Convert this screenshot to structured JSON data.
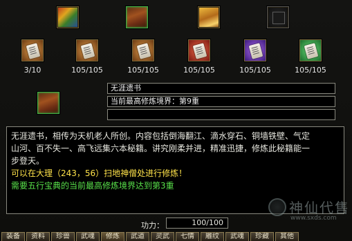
{
  "top_slots": [
    {
      "icon": "multicolor-book-icon",
      "selected": false
    },
    {
      "icon": "scroll-bundle-icon",
      "selected": true
    },
    {
      "icon": "golden-scroll-icon",
      "selected": false
    },
    {
      "icon": "empty-slot-icon",
      "selected": false
    }
  ],
  "scroll_slots": [
    {
      "icon": "white-scroll-icon",
      "color": "#b07a3a",
      "count": "3/10"
    },
    {
      "icon": "white-scroll-icon",
      "color": "#b07a3a",
      "count": "105/105"
    },
    {
      "icon": "white-scroll-icon",
      "color": "#b07a3a",
      "count": "105/105"
    },
    {
      "icon": "white-scroll-icon",
      "color": "#c0342a",
      "count": "105/105"
    },
    {
      "icon": "white-scroll-icon",
      "color": "#6a2ab0",
      "count": "105/105"
    },
    {
      "icon": "white-scroll-icon",
      "color": "#2a9a3a",
      "count": "105/105"
    }
  ],
  "book": {
    "name": "无涯遗书",
    "realm": "当前最高修炼境界：第9重",
    "extra": ""
  },
  "description": {
    "line1": "无涯遗书，相传为天机老人所创。内容包括倒海翻江、滴水穿石、铜墙铁壁、气定",
    "line2": "山河、百不失一、高飞远集六本秘籍。讲究刚柔并进，精准迅捷，修炼此秘籍能一",
    "line3": "步登天。",
    "hint": "可以在大理（243，56）扫地神僧处进行修炼！",
    "requirement": "需要五行宝典的当前最高修炼境界达到第3重"
  },
  "power": {
    "label": "功力：",
    "value": "100/100"
  },
  "tabs": [
    "装备",
    "资料",
    "珍兽",
    "武魂",
    "修炼",
    "武道",
    "灵武",
    "七情",
    "雕纹",
    "武魂",
    "珍藏",
    "其他"
  ],
  "watermark": {
    "text": "神仙代售",
    "url": "www.sxds.com"
  }
}
